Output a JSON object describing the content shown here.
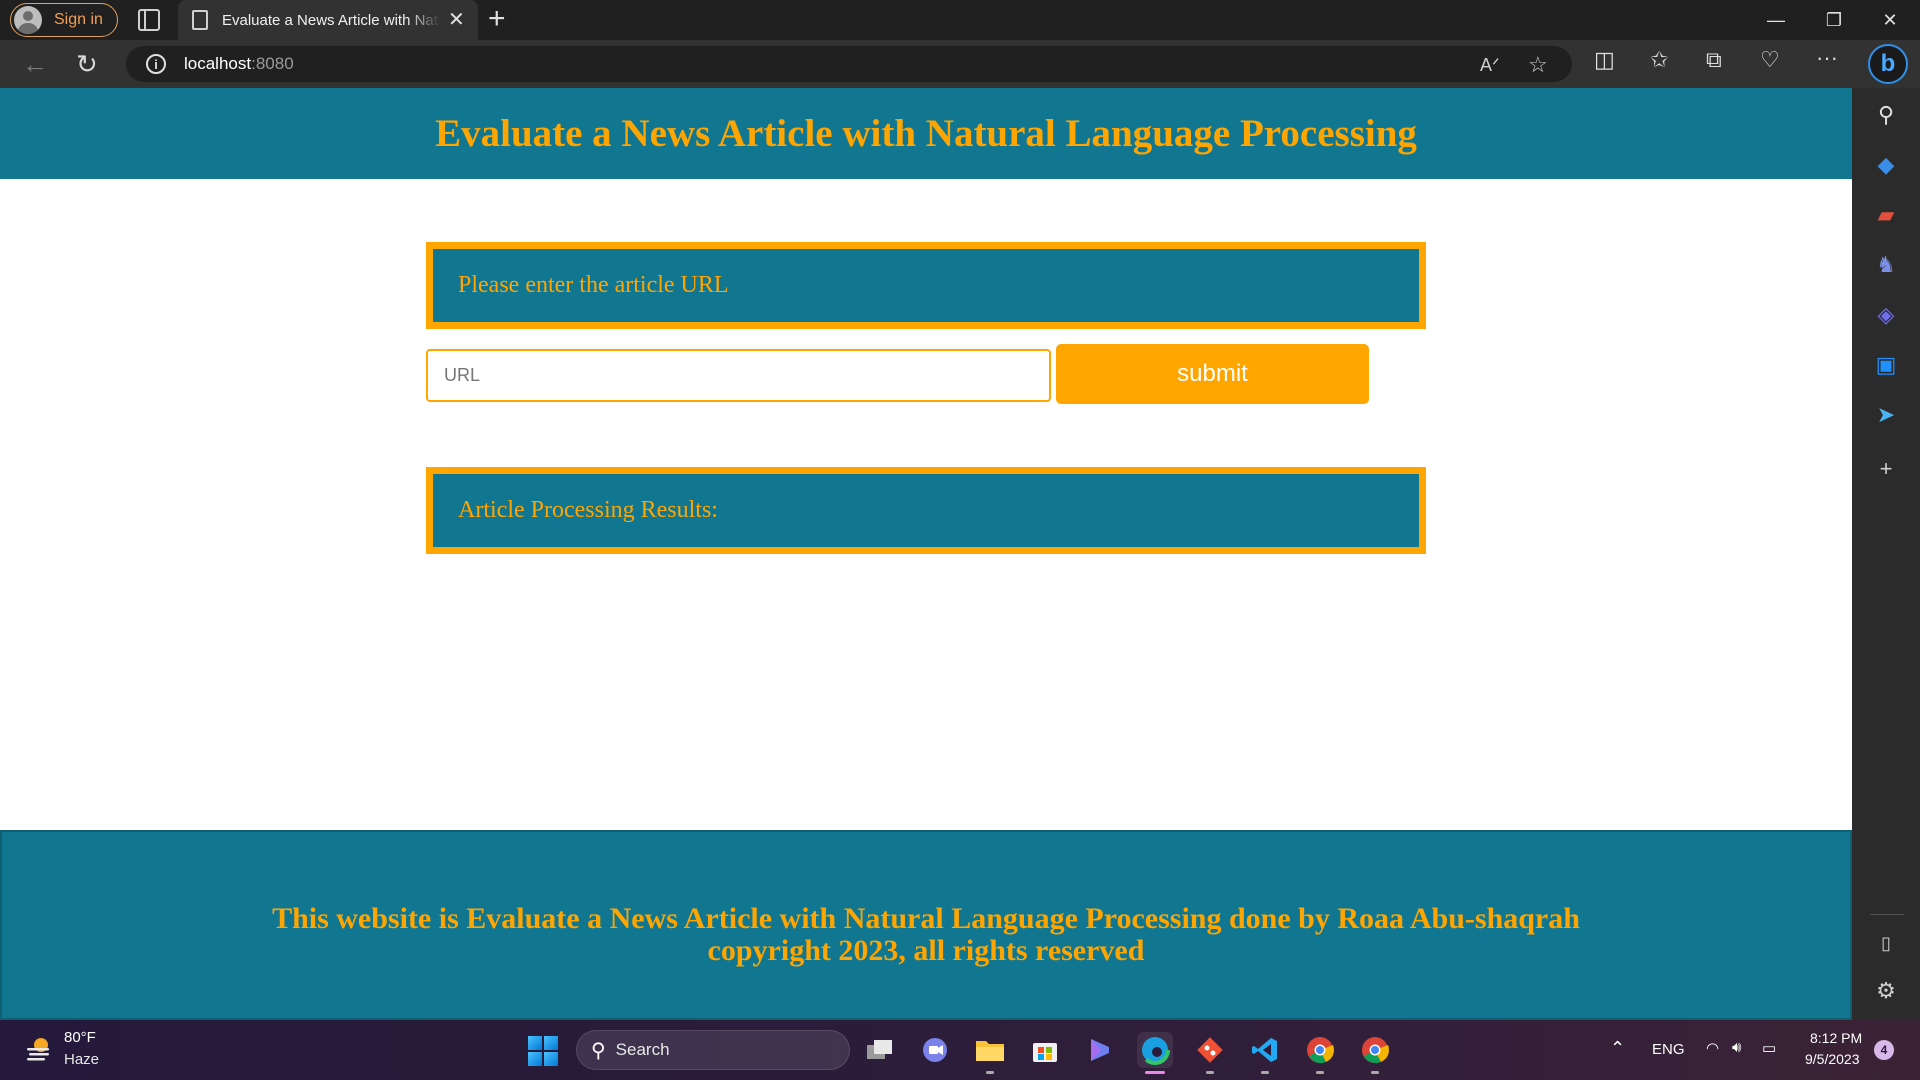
{
  "browser": {
    "signin_label": "Sign in",
    "tab_title": "Evaluate a News Article with Natural Language Processing",
    "address_host": "localhost",
    "address_port": ":8080"
  },
  "page": {
    "header_title": "Evaluate a News Article with Natural Language Processing",
    "prompt_text": "Please enter the article URL",
    "url_placeholder": "URL",
    "url_value": "",
    "submit_label": "submit",
    "results_title": "Article Processing Results:",
    "footer_line1": "This website is Evaluate a News Article with Natural Language Processing done by Roaa Abu-shaqrah",
    "footer_line2": "copyright 2023, all rights reserved"
  },
  "colors": {
    "teal": "#117790",
    "orange": "#ffa500",
    "white": "#ffffff"
  },
  "sidebar_icons": [
    "search-icon",
    "tag-icon",
    "toolbox-icon",
    "chess-icon",
    "copilot-icon",
    "outlook-icon",
    "send-icon",
    "add-icon",
    "sidebar-toggle-icon",
    "settings-icon"
  ],
  "taskbar": {
    "weather_temp": "80°F",
    "weather_desc": "Haze",
    "search_label": "Search",
    "language": "ENG",
    "time": "8:12 PM",
    "date": "9/5/2023",
    "notification_count": "4"
  }
}
